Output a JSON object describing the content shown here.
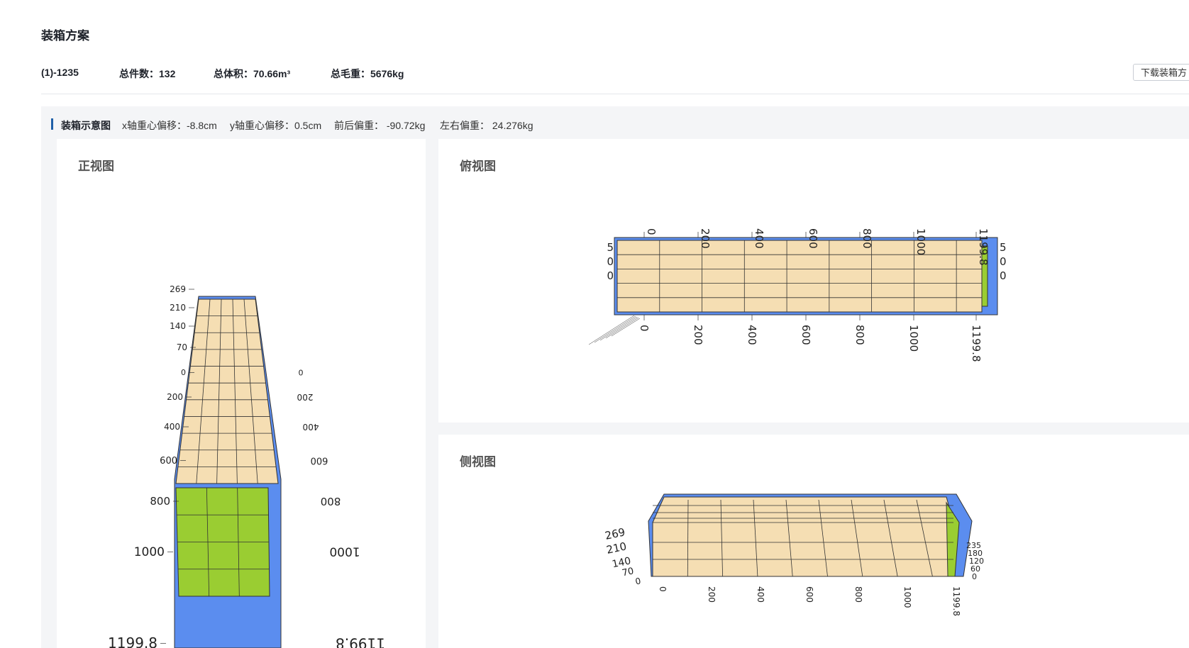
{
  "page": {
    "title": "装箱方案"
  },
  "summary": {
    "container": "(1)-1235",
    "total_pieces": "总件数：132",
    "total_volume": "总体积：70.66m³",
    "total_weight": "总毛重：5676kg"
  },
  "actions": {
    "download_label": "下载装箱方"
  },
  "diagram_header": {
    "label": "装箱示意图",
    "x_offset": "x轴重心偏移：-8.8cm",
    "y_offset": "y轴重心偏移：0.5cm",
    "front_back": "前后偏重：  -90.72kg",
    "left_right": "左右偏重：  24.276kg"
  },
  "views": {
    "front": {
      "title": "正视图",
      "left_ticks": [
        "269",
        "210",
        "140",
        "70",
        "0",
        "200",
        "400",
        "600",
        "800",
        "1000",
        "1199.8"
      ],
      "right_ticks": [
        "0",
        "200",
        "400",
        "600",
        "800",
        "1000",
        "1199.8"
      ]
    },
    "top": {
      "title": "俯视图",
      "ticks": [
        "0",
        "200",
        "400",
        "600",
        "800",
        "1000",
        "1199.8"
      ],
      "side_left": [
        "5",
        "0",
        "0"
      ],
      "side_right": [
        "5",
        "0",
        "0"
      ]
    },
    "side": {
      "title": "侧视图",
      "left_ticks": [
        "269",
        "210",
        "140",
        "70",
        "0"
      ],
      "bottom_ticks": [
        "0",
        "200",
        "400",
        "600",
        "800",
        "1000",
        "1199.8"
      ],
      "right_ticks": [
        "235",
        "180",
        "120",
        "60",
        "0"
      ]
    }
  },
  "colors": {
    "cargo_tan": "#f5deb3",
    "cargo_green": "#9acd32",
    "container_blue": "#5b8def",
    "accent": "#1f5fa8"
  }
}
